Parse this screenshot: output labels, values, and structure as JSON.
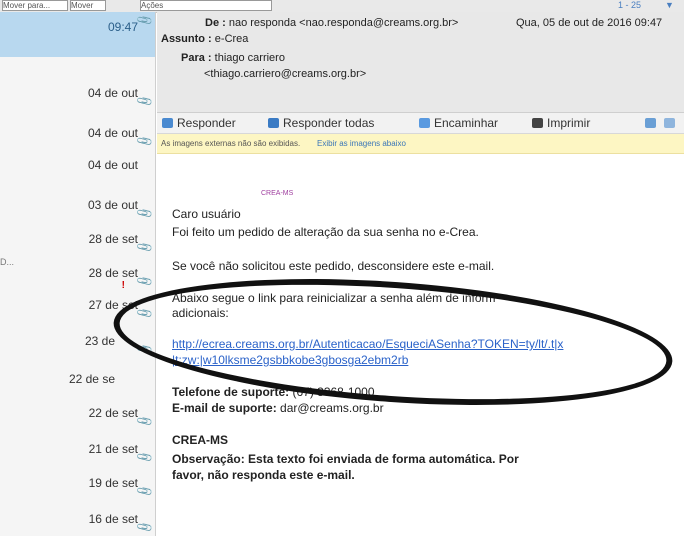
{
  "topbar": {
    "move_label": "Mover para...",
    "move2_label": "Mover",
    "actions_label": "Ações",
    "pager": "1 - 25"
  },
  "message_list": [
    {
      "date": "09:47",
      "selected": true
    },
    {
      "date": "04 de out"
    },
    {
      "date": "04 de out"
    },
    {
      "date": "04 de out"
    },
    {
      "date": "03 de out"
    },
    {
      "date": "28 de set"
    },
    {
      "date": "28 de set",
      "flagged": true
    },
    {
      "date": "27 de set"
    },
    {
      "date": "23 de"
    },
    {
      "date": "22 de se"
    },
    {
      "date": "22 de set"
    },
    {
      "date": "21 de set"
    },
    {
      "date": "19 de set"
    },
    {
      "date": "16 de set"
    }
  ],
  "header": {
    "from_label": "De :",
    "from_value": "nao responda <nao.responda@creams.org.br>",
    "date_value": "Qua, 05 de out de 2016 09:47",
    "subject_label": "Assunto :",
    "subject_value": "e-Crea",
    "to_label": "Para :",
    "to_name": "thiago carriero",
    "to_email": "<thiago.carriero@creams.org.br>"
  },
  "actions": {
    "reply": "Responder",
    "reply_all": "Responder todas",
    "forward": "Encaminhar",
    "print": "Imprimir"
  },
  "notice": {
    "text": "As imagens externas não são exibidas.",
    "link": "Exibir as imagens abaixo"
  },
  "body": {
    "org_logo": "CREA-MS",
    "greeting": "Caro usuário",
    "line1": "Foi feito um pedido de alteração da sua senha no e-Crea.",
    "line2": "Se você não solicitou este pedido, desconsidere este e-mail.",
    "line3a": "Abaixo segue o link para reinicializar a senha além de inform",
    "line3b": "adicionais:",
    "url1": "http://ecrea.creams.org.br/Autenticacao/EsqueciASenha?TOKEN=ty/lt/.t|x",
    "url2": "|t:zw:|w10lksme2gsbbkobe3gbosga2ebm2rb",
    "phone_label": "Telefone de suporte:",
    "phone_value": "(67) 3368-1000",
    "email_label": "E-mail de suporte:",
    "email_value": "dar@creams.org.br",
    "signature": "CREA-MS",
    "note1": "Observação: Esta texto foi enviada de forma automática. Por",
    "note2": "favor, não responda este e-mail."
  },
  "colors": {
    "selected_row": "#b8d8ef",
    "link": "#2a62c9",
    "notice_bg": "#fdf6c3"
  }
}
